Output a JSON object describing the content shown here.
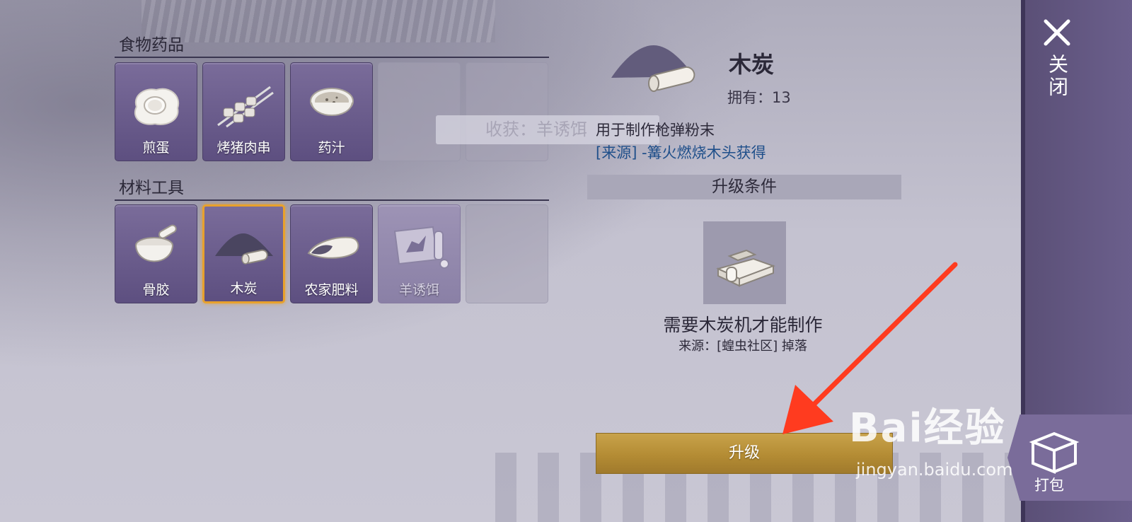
{
  "sections": {
    "food": {
      "title": "食物药品",
      "items": [
        {
          "label": "煎蛋",
          "icon": "fried-egg-icon"
        },
        {
          "label": "烤猪肉串",
          "icon": "pork-skewer-icon"
        },
        {
          "label": "药汁",
          "icon": "medicine-bowl-icon"
        }
      ]
    },
    "materials": {
      "title": "材料工具",
      "items": [
        {
          "label": "骨胶",
          "icon": "mortar-icon"
        },
        {
          "label": "木炭",
          "icon": "charcoal-icon",
          "selected": true
        },
        {
          "label": "农家肥料",
          "icon": "fertilizer-sack-icon"
        },
        {
          "label": "羊诱饵",
          "icon": "goat-bait-icon",
          "dim": true
        }
      ]
    }
  },
  "toast": "收获：羊诱饵",
  "detail": {
    "name": "木炭",
    "owned_label": "拥有：",
    "owned_value": "13",
    "description": "用于制作枪弹粉末",
    "source": "[来源] -篝火燃烧木头获得",
    "upgrade_header": "升级条件",
    "requirement": "需要木炭机才能制作",
    "requirement_source": "来源：[蝗虫社区] 掉落",
    "upgrade_button": "升级"
  },
  "side": {
    "close_label": "关闭",
    "pack_label": "打包"
  },
  "watermark": {
    "brand": "Bai经验",
    "url": "jingyan.baidu.com"
  },
  "colors": {
    "slot": "#6a5c8c",
    "selected_border": "#e8a12c",
    "upgrade_button": "#b48c34",
    "arrow": "#ff3b1f",
    "link": "#1f4f8a"
  }
}
